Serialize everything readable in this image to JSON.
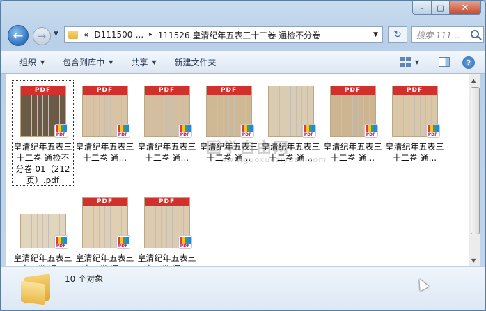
{
  "window": {
    "caption": {
      "minimize": "–",
      "maximize": "□",
      "close": "✕"
    }
  },
  "nav": {
    "back_glyph": "←",
    "forward_glyph": "→",
    "address": {
      "chevron": "«",
      "segment1": "D111500-...",
      "separator": "▸",
      "segment2": "111526 皇清纪年五表三十二卷 通检不分卷"
    },
    "search_placeholder": "搜索 111..."
  },
  "toolbar": {
    "organize": "组织",
    "include_in_library": "包含到库中",
    "share": "共享",
    "new_folder": "新建文件夹"
  },
  "files": [
    {
      "label": "皇清纪年五表三十二卷 通检不分卷 01（212页）.pdf",
      "selected": true,
      "page_color": "#6b5a45"
    },
    {
      "label": "皇清纪年五表三十二卷 通...",
      "page_color": "#d8c3a4"
    },
    {
      "label": "皇清纪年五表三十二卷 通...",
      "page_color": "#d3bea0"
    },
    {
      "label": "皇清纪年五表三十二卷 通...",
      "page_color": "#cfb995"
    },
    {
      "label": "皇清纪年五表三十二卷 通...",
      "page_color": "#d9ccb3"
    },
    {
      "label": "皇清纪年五表三十二卷 通...",
      "page_color": "#ceb591"
    },
    {
      "label": "皇清纪年五表三十二卷 通...",
      "page_color": "#dac7a8"
    },
    {
      "label": "皇清纪年五表三十二卷 通...",
      "page_color": "#e2d5bd"
    },
    {
      "label": "皇清纪年五表三十二卷 通...",
      "page_color": "#e0cfb3"
    },
    {
      "label": "皇清纪年五表三十二卷 通...",
      "page_color": "#dccbb0"
    }
  ],
  "pdf_tag": "PDF",
  "badge_text": "PDF",
  "status": {
    "count": "10 个对象"
  },
  "watermark": {
    "line1": "国学自由网",
    "line2": "www.guoxueziyuan.com"
  },
  "colors": {
    "pdf_red": "#d0312d",
    "selection_outline": "#333333"
  }
}
